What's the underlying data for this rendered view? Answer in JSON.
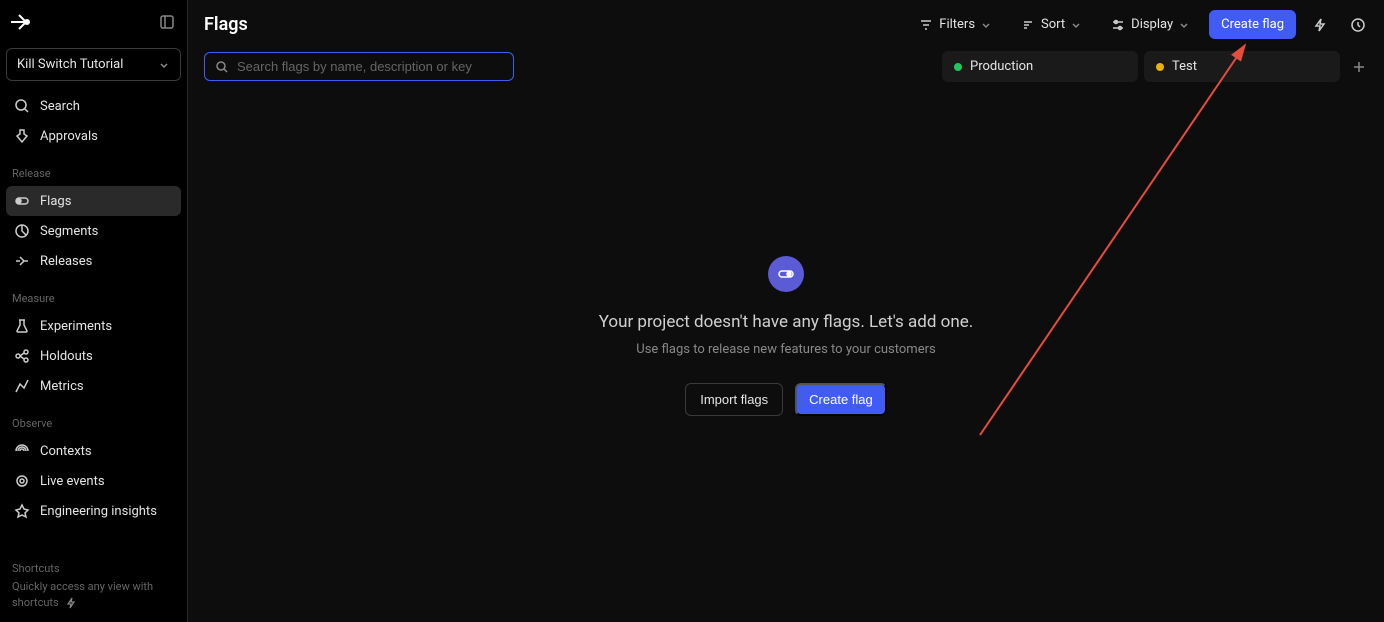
{
  "project": {
    "name": "Kill Switch Tutorial"
  },
  "sidebar": {
    "top": [
      {
        "label": "Search",
        "icon": "search-icon"
      },
      {
        "label": "Approvals",
        "icon": "approvals-icon"
      }
    ],
    "sections": [
      {
        "label": "Release",
        "items": [
          {
            "label": "Flags",
            "icon": "flag-icon",
            "active": true
          },
          {
            "label": "Segments",
            "icon": "segments-icon"
          },
          {
            "label": "Releases",
            "icon": "releases-icon"
          }
        ]
      },
      {
        "label": "Measure",
        "items": [
          {
            "label": "Experiments",
            "icon": "beaker-icon"
          },
          {
            "label": "Holdouts",
            "icon": "holdouts-icon"
          },
          {
            "label": "Metrics",
            "icon": "metrics-icon"
          }
        ]
      },
      {
        "label": "Observe",
        "items": [
          {
            "label": "Contexts",
            "icon": "contexts-icon"
          },
          {
            "label": "Live events",
            "icon": "live-events-icon"
          },
          {
            "label": "Engineering insights",
            "icon": "insights-icon"
          }
        ]
      }
    ],
    "shortcuts": {
      "title": "Shortcuts",
      "desc": "Quickly access any view with shortcuts"
    }
  },
  "header": {
    "title": "Flags",
    "filters": "Filters",
    "sort": "Sort",
    "display": "Display",
    "create": "Create flag"
  },
  "search": {
    "placeholder": "Search flags by name, description or key"
  },
  "environments": [
    {
      "name": "Production",
      "color": "green"
    },
    {
      "name": "Test",
      "color": "yellow"
    }
  ],
  "empty": {
    "title": "Your project doesn't have any flags. Let's add one.",
    "subtitle": "Use flags to release new features to your customers",
    "import": "Import flags",
    "create": "Create flag"
  }
}
